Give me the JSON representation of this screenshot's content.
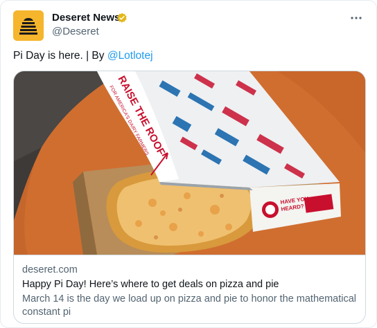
{
  "author": {
    "name": "Deseret News",
    "handle": "@Deseret",
    "verified_badge_color": "#e2b719",
    "avatar_color": "#f5b52d"
  },
  "menu": {
    "icon": "more-horizontal-icon"
  },
  "tweet": {
    "text_prefix": "Pi Day is here. | By ",
    "mention": "@Lotlotej"
  },
  "link_card": {
    "domain": "deseret.com",
    "title": "Happy Pi Day! Here’s where to get deals on pizza and pie",
    "description": "March 14 is the day we load up on pizza and pie to honor the mathematical constant pi",
    "image_box_text": {
      "lid_main": "RAISE THE ROOF",
      "lid_sub": "FOR AMERICA'S DAIRY FARMERS",
      "side": "HAVE YOU HEARD?"
    }
  },
  "colors": {
    "text": "#0f1419",
    "secondary": "#536471",
    "link": "#1d9bf0",
    "border": "#cfd9de"
  }
}
